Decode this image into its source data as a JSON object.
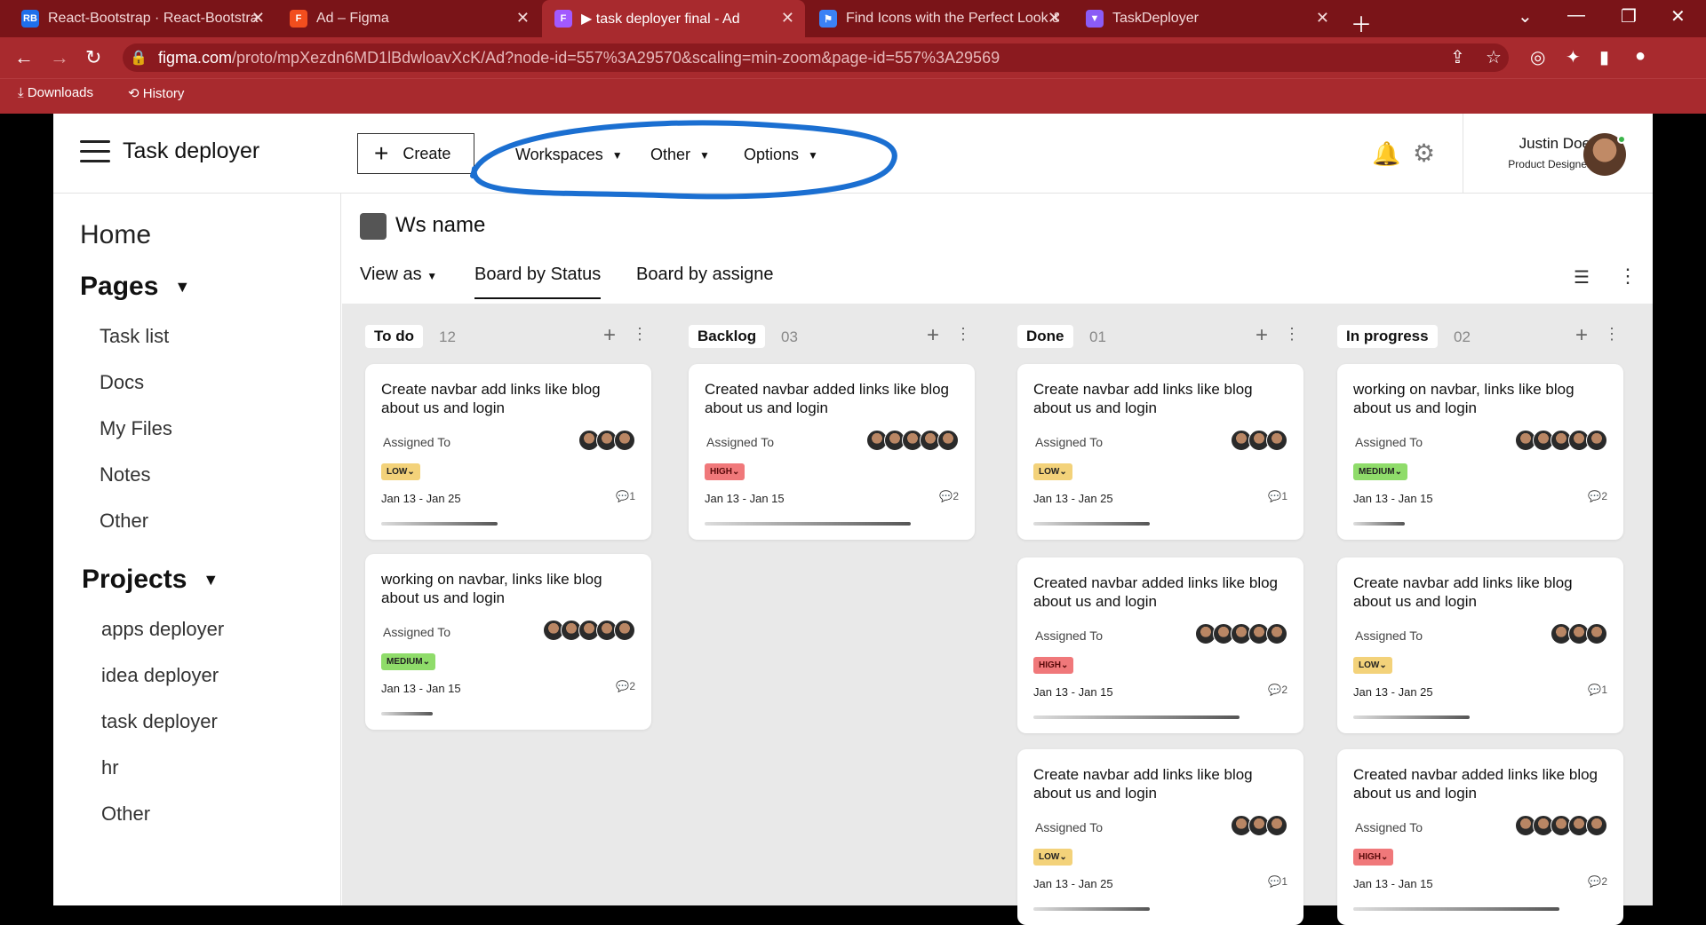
{
  "browser": {
    "tabs": [
      {
        "title": "React-Bootstrap · React-Bootstra",
        "icon": "react-bootstrap-icon",
        "color": "#1f6feb",
        "glyph": "RB"
      },
      {
        "title": "Ad – Figma",
        "icon": "figma-icon",
        "color": "#f24e1e",
        "glyph": "F"
      },
      {
        "title": "▶ task deployer final - Ad",
        "icon": "figma-icon",
        "color": "#a259ff",
        "glyph": "F"
      },
      {
        "title": "Find Icons with the Perfect Look &",
        "icon": "flag-icon",
        "color": "#3b82f6",
        "glyph": "⚑"
      },
      {
        "title": "TaskDeployer",
        "icon": "vite-icon",
        "color": "#8b5cf6",
        "glyph": "▼"
      }
    ],
    "url": {
      "host": "figma.com",
      "path": "/proto/mpXezdn6MD1lBdwloavXcK/Ad?node-id=557%3A29570&scaling=min-zoom&page-id=557%3A29569"
    },
    "bookmarks": [
      "Downloads",
      "History"
    ]
  },
  "app": {
    "brand": "Task deployer",
    "create_label": "Create",
    "menus": [
      "Workspaces",
      "Other",
      "Options"
    ],
    "user": {
      "name": "Justin Doe",
      "role": "Product Designer"
    }
  },
  "sidebar": {
    "home": "Home",
    "pages_title": "Pages",
    "pages": [
      "Task list",
      "Docs",
      "My Files",
      "Notes",
      "Other"
    ],
    "projects_title": "Projects",
    "projects": [
      "apps deployer",
      "idea deployer",
      "task deployer",
      "hr",
      "Other"
    ]
  },
  "workspace": {
    "name": "Ws name",
    "view_as": "View as",
    "tabs": [
      "Board by Status",
      "Board by assigne"
    ]
  },
  "columns": [
    {
      "name": "To do",
      "count": "12",
      "cards": [
        {
          "title": "Create navbar add links like blog about us and login",
          "assigned": "Assigned To",
          "avatars": 3,
          "priority": "LOW",
          "level": "low",
          "dates": "Jan 13 - Jan 25",
          "comments": "1",
          "progress": 0.45
        },
        {
          "title": "working on navbar, links like blog about us and login",
          "assigned": "Assigned To",
          "avatars": 5,
          "priority": "MEDIUM",
          "level": "med",
          "dates": "Jan 13 - Jan 15",
          "comments": "2",
          "progress": 0.2
        }
      ]
    },
    {
      "name": "Backlog",
      "count": "03",
      "cards": [
        {
          "title": "Created navbar added links like blog about us and login",
          "assigned": "Assigned To",
          "avatars": 5,
          "priority": "HIGH",
          "level": "high",
          "dates": "Jan 13 - Jan 15",
          "comments": "2",
          "progress": 0.8
        }
      ]
    },
    {
      "name": "Done",
      "count": "01",
      "cards": [
        {
          "title": "Create navbar add links like blog about us and login",
          "assigned": "Assigned To",
          "avatars": 3,
          "priority": "LOW",
          "level": "low",
          "dates": "Jan 13 - Jan 25",
          "comments": "1",
          "progress": 0.45
        },
        {
          "title": "Created navbar added links like blog about us and login",
          "assigned": "Assigned To",
          "avatars": 5,
          "priority": "HIGH",
          "level": "high",
          "dates": "Jan 13 - Jan 15",
          "comments": "2",
          "progress": 0.8
        },
        {
          "title": "Create navbar add links like blog about us and login",
          "assigned": "Assigned To",
          "avatars": 3,
          "priority": "LOW",
          "level": "low",
          "dates": "Jan 13 - Jan 25",
          "comments": "1",
          "progress": 0.45
        }
      ]
    },
    {
      "name": "In progress",
      "count": "02",
      "cards": [
        {
          "title": "working on navbar, links like blog about us and login",
          "assigned": "Assigned To",
          "avatars": 5,
          "priority": "MEDIUM",
          "level": "med",
          "dates": "Jan 13 - Jan 15",
          "comments": "2",
          "progress": 0.2
        },
        {
          "title": "Create navbar add links like blog about us and login",
          "assigned": "Assigned To",
          "avatars": 3,
          "priority": "LOW",
          "level": "low",
          "dates": "Jan 13 - Jan 25",
          "comments": "1",
          "progress": 0.45
        },
        {
          "title": "Created navbar added links like blog about us and login",
          "assigned": "Assigned To",
          "avatars": 5,
          "priority": "HIGH",
          "level": "high",
          "dates": "Jan 13 - Jan 15",
          "comments": "2",
          "progress": 0.8
        }
      ]
    }
  ]
}
